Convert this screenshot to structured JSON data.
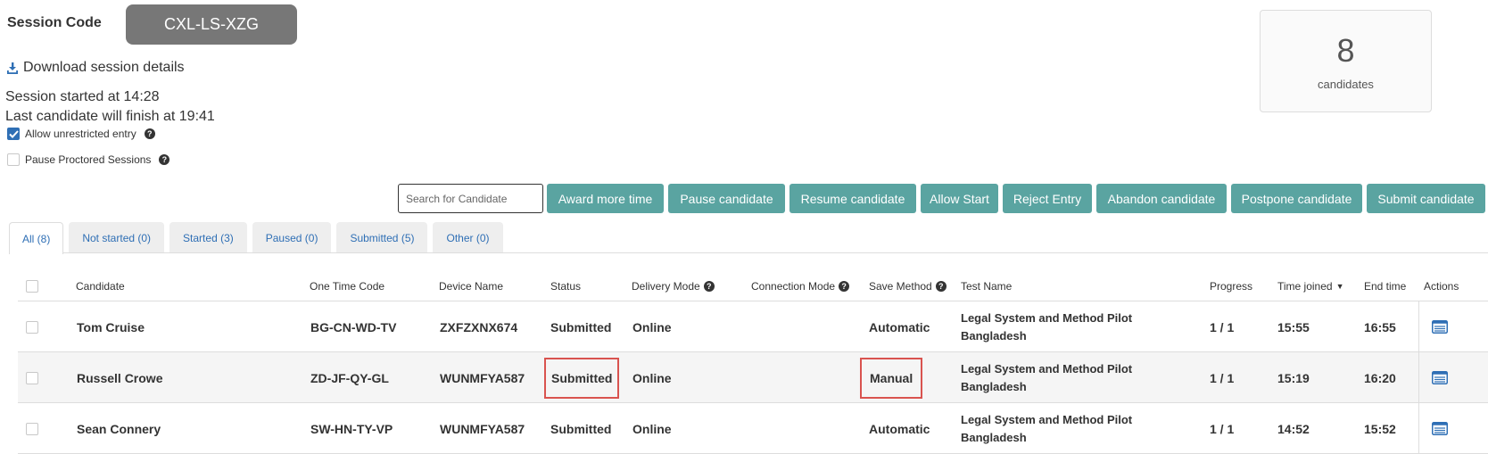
{
  "session": {
    "label": "Session Code",
    "code": "CXL-LS-XZG",
    "download_label": "Download session details",
    "started_text": "Session started at 14:28",
    "last_finish_text": "Last candidate will finish at 19:41",
    "allow_unrestricted_label": "Allow unrestricted entry",
    "allow_unrestricted_checked": true,
    "pause_proctored_label": "Pause Proctored Sessions",
    "pause_proctored_checked": false
  },
  "count_card": {
    "number": "8",
    "label": "candidates"
  },
  "toolbar": {
    "search_placeholder": "Search for Candidate",
    "buttons": [
      "Award more time",
      "Pause candidate",
      "Resume candidate",
      "Allow Start",
      "Reject Entry",
      "Abandon candidate",
      "Postpone candidate",
      "Submit candidate"
    ],
    "button_color": "#5aa4a1"
  },
  "tabs": [
    {
      "label": "All (8)",
      "active": true
    },
    {
      "label": "Not started (0)",
      "active": false
    },
    {
      "label": "Started (3)",
      "active": false
    },
    {
      "label": "Paused (0)",
      "active": false
    },
    {
      "label": "Submitted (5)",
      "active": false
    },
    {
      "label": "Other (0)",
      "active": false
    }
  ],
  "table": {
    "columns": {
      "candidate": "Candidate",
      "one_time_code": "One Time Code",
      "device_name": "Device Name",
      "status": "Status",
      "delivery_mode": "Delivery Mode",
      "connection_mode": "Connection Mode",
      "save_method": "Save Method",
      "test_name": "Test Name",
      "progress": "Progress",
      "time_joined": "Time joined",
      "end_time": "End time",
      "actions": "Actions"
    },
    "rows": [
      {
        "candidate": "Tom Cruise",
        "one_time_code": "BG-CN-WD-TV",
        "device_name": "ZXFZXNX674",
        "status": "Submitted",
        "delivery_mode": "Online",
        "connection_mode": "",
        "save_method": "Automatic",
        "test_name_line1": "Legal System and Method Pilot",
        "test_name_line2": "Bangladesh",
        "progress": "1 / 1",
        "time_joined": "15:55",
        "end_time": "16:55"
      },
      {
        "candidate": "Russell Crowe",
        "one_time_code": "ZD-JF-QY-GL",
        "device_name": "WUNMFYA587",
        "status": "Submitted",
        "delivery_mode": "Online",
        "connection_mode": "",
        "save_method": "Manual",
        "test_name_line1": "Legal System and Method Pilot",
        "test_name_line2": "Bangladesh",
        "progress": "1 / 1",
        "time_joined": "15:19",
        "end_time": "16:20"
      },
      {
        "candidate": "Sean Connery",
        "one_time_code": "SW-HN-TY-VP",
        "device_name": "WUNMFYA587",
        "status": "Submitted",
        "delivery_mode": "Online",
        "connection_mode": "",
        "save_method": "Automatic",
        "test_name_line1": "Legal System and Method Pilot",
        "test_name_line2": "Bangladesh",
        "progress": "1 / 1",
        "time_joined": "14:52",
        "end_time": "15:52"
      }
    ]
  },
  "colors": {
    "accent": "#2f6fb5",
    "highlight": "#d9534f"
  }
}
